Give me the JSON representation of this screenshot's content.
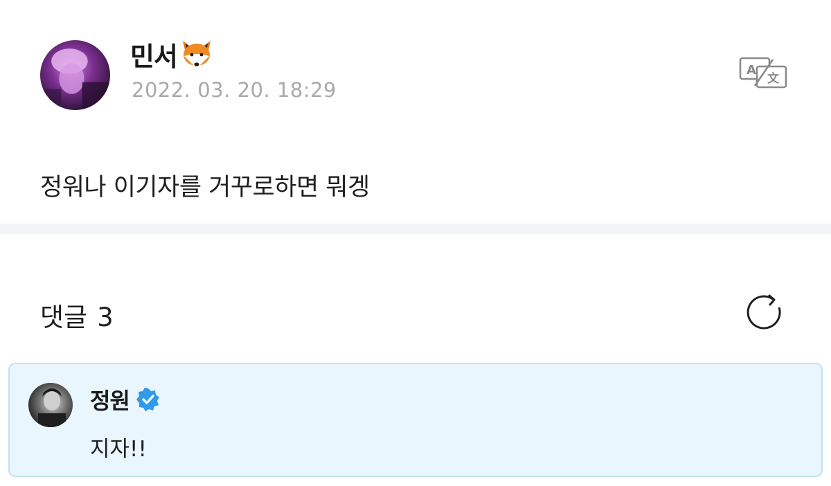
{
  "post": {
    "author_name": "민서",
    "author_emoji_icon": "fox-face-icon",
    "date": "2022. 03. 20. 18:29",
    "body": "정워나 이기자를 거꾸로하면 뭐겡",
    "translate_icon": "translate-icon"
  },
  "comments": {
    "label": "댓글",
    "count": "3",
    "refresh_icon": "refresh-icon",
    "items": [
      {
        "author": "정원",
        "verified_icon": "verified-badge-icon",
        "text": "지자!!"
      }
    ]
  },
  "colors": {
    "date_gray": "#a9a9a9",
    "divider": "#f3f4f6",
    "comment_bg": "#e9f6fd",
    "comment_border": "#bfe2f3",
    "verified_blue": "#2f9bea"
  }
}
